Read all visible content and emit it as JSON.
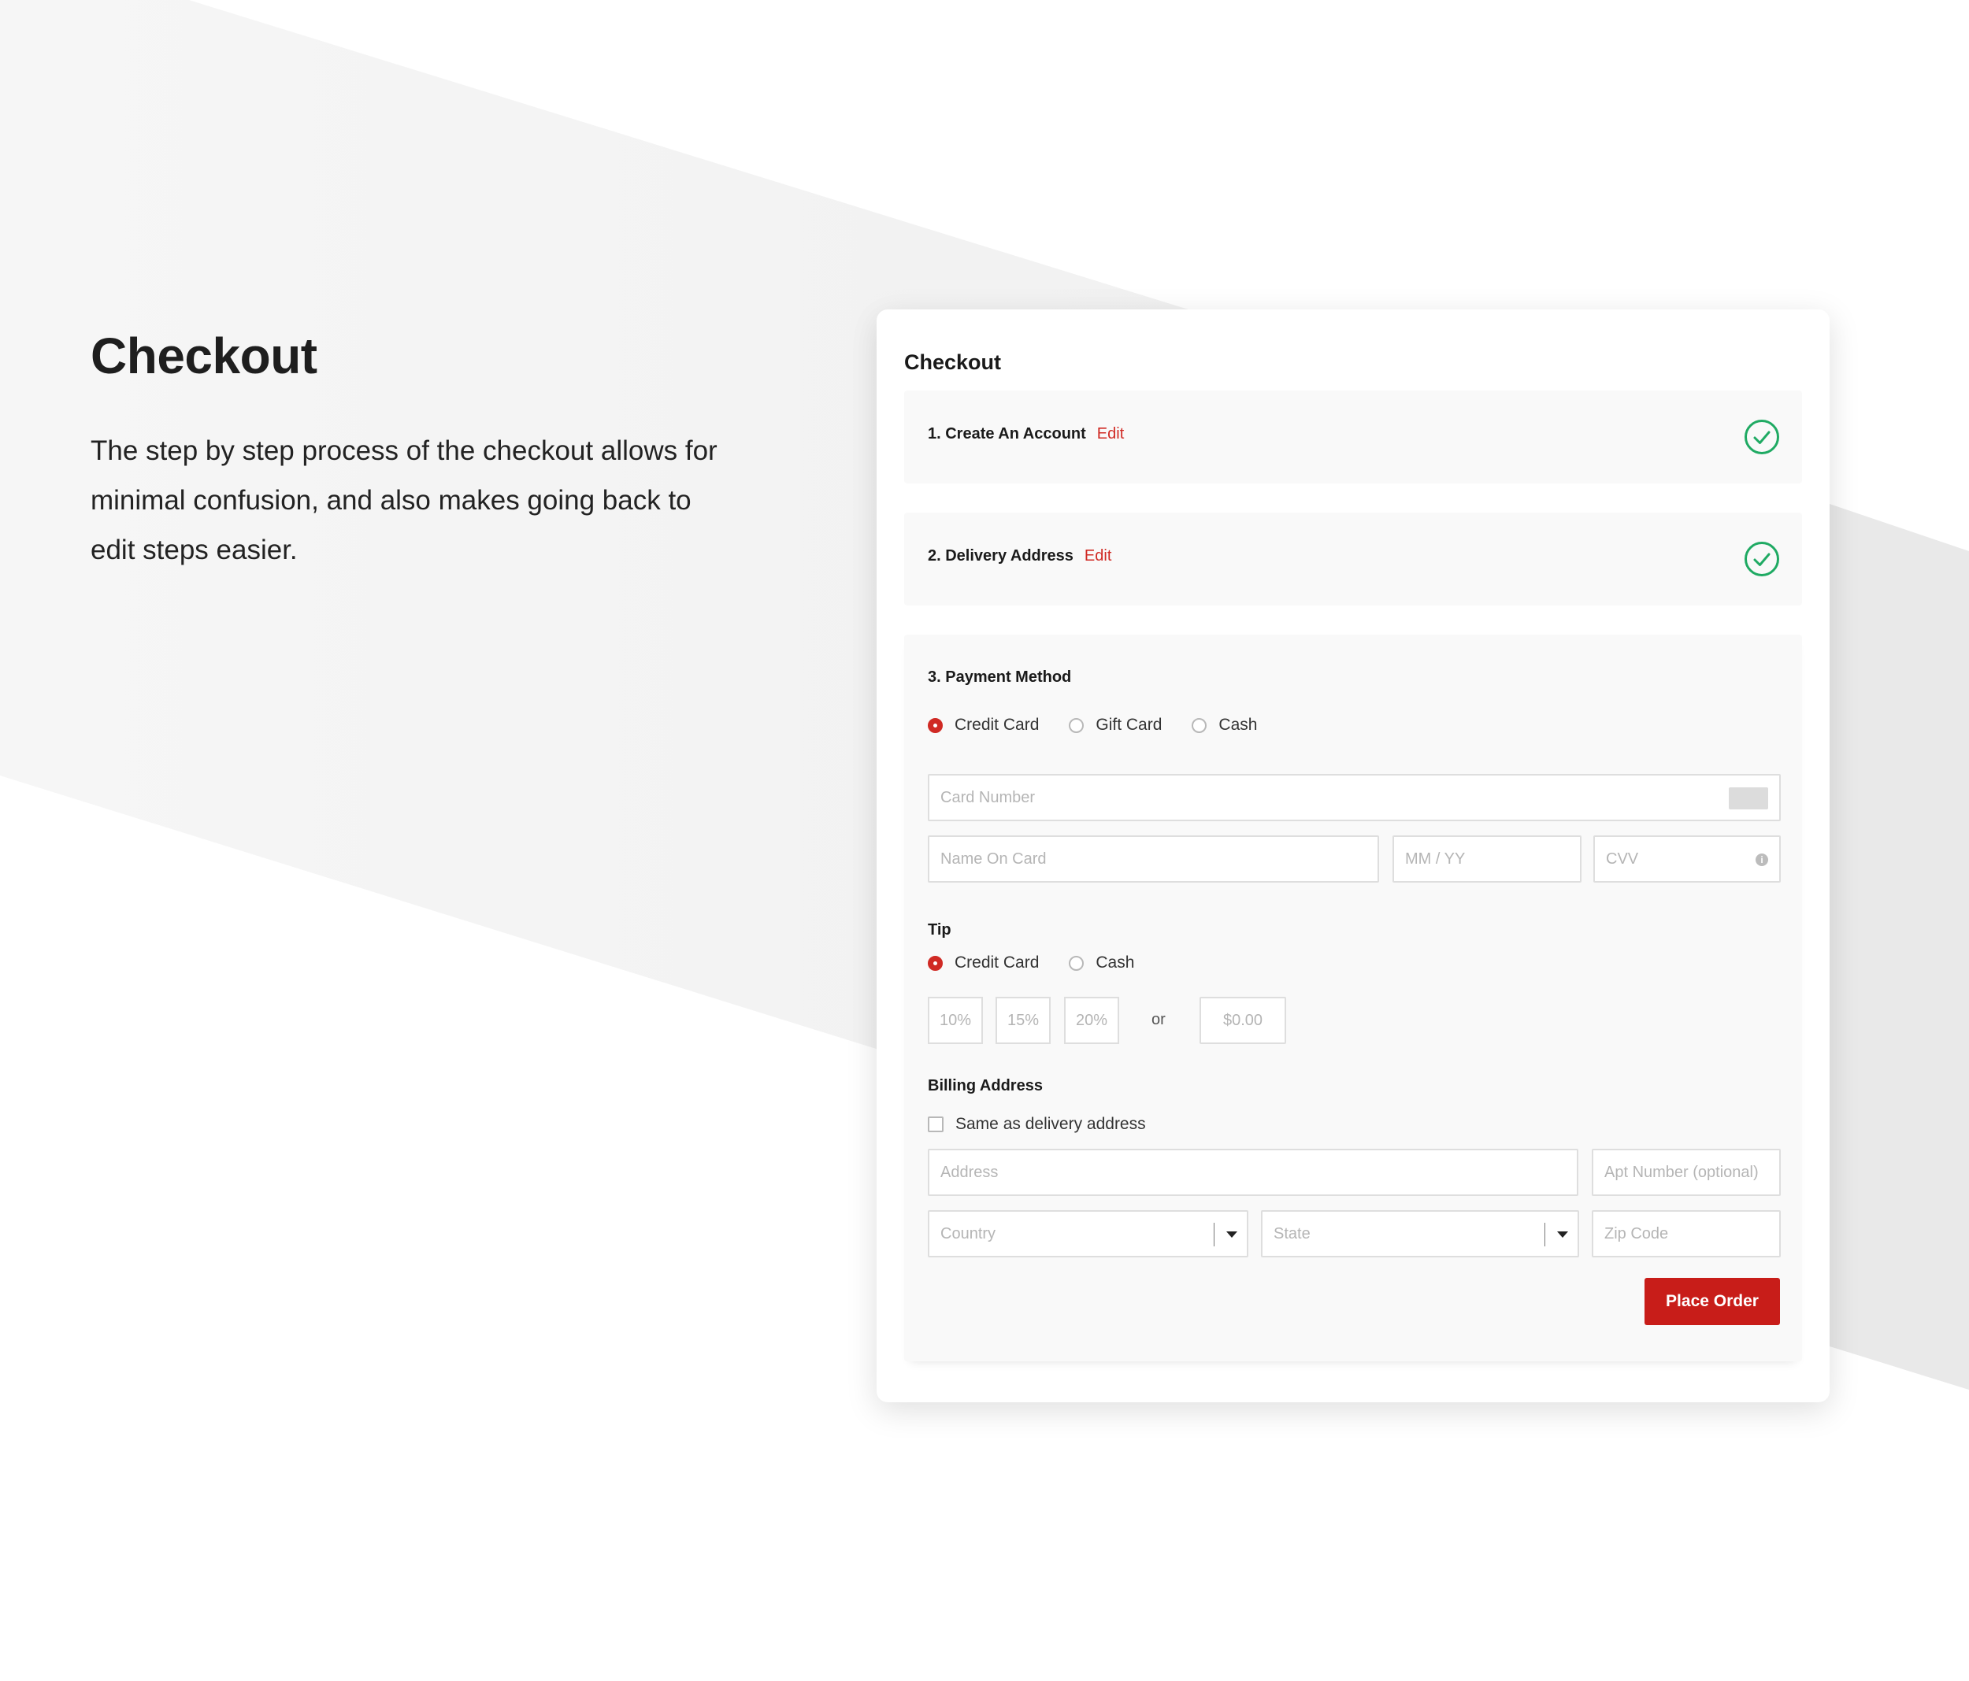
{
  "intro": {
    "title": "Checkout",
    "description": "The step by step process of the checkout allows for minimal confusion, and also makes going back to edit steps easier."
  },
  "card": {
    "title": "Checkout",
    "steps": [
      {
        "label": "1. Create An Account",
        "edit": "Edit",
        "status": "complete"
      },
      {
        "label": "2. Delivery Address",
        "edit": "Edit",
        "status": "complete"
      }
    ],
    "payment": {
      "title": "3. Payment Method",
      "methods": [
        {
          "label": "Credit Card",
          "selected": true
        },
        {
          "label": "Gift Card",
          "selected": false
        },
        {
          "label": "Cash",
          "selected": false
        }
      ],
      "card_number_placeholder": "Card Number",
      "name_placeholder": "Name On Card",
      "expiry_placeholder": "MM / YY",
      "cvv_placeholder": "CVV"
    },
    "tip": {
      "title": "Tip",
      "methods": [
        {
          "label": "Credit Card",
          "selected": true
        },
        {
          "label": "Cash",
          "selected": false
        }
      ],
      "options": [
        "10%",
        "15%",
        "20%"
      ],
      "or_label": "or",
      "custom_placeholder": "$0.00"
    },
    "billing": {
      "title": "Billing Address",
      "same_as_delivery": "Same as delivery address",
      "address_placeholder": "Address",
      "apt_placeholder": "Apt Number (optional)",
      "country_placeholder": "Country",
      "state_placeholder": "State",
      "zip_placeholder": "Zip Code"
    },
    "place_order": "Place Order"
  },
  "colors": {
    "accent": "#c81d19",
    "success": "#1faa63",
    "panel": "#f9f9f9"
  }
}
